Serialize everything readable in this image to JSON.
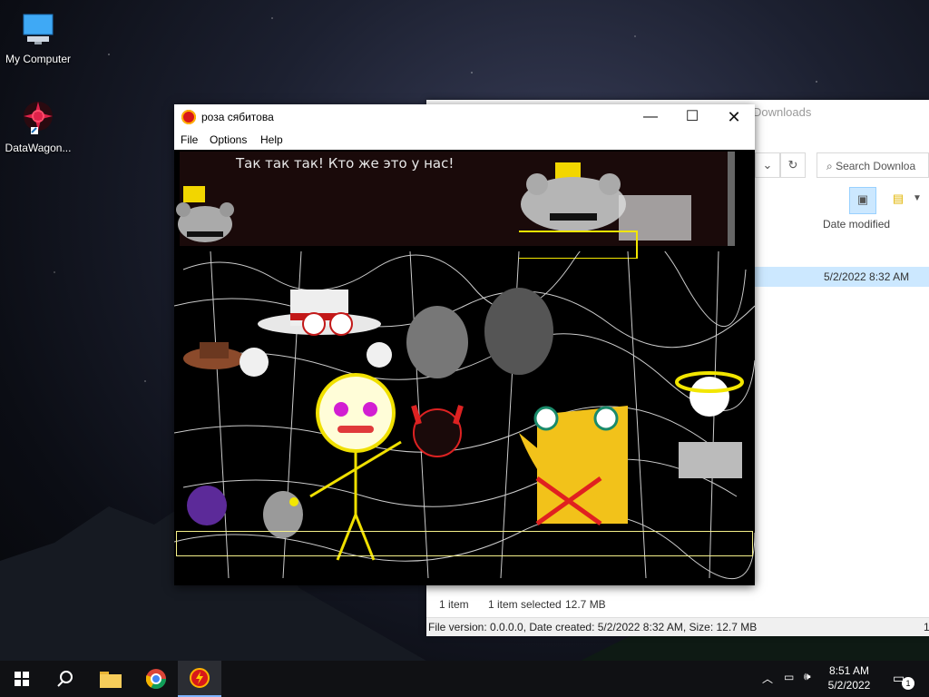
{
  "desktop": {
    "icons": [
      {
        "label": "My Computer",
        "icon": "computer-icon"
      },
      {
        "label": "DataWagon...",
        "icon": "datawagon-shortcut-icon"
      }
    ]
  },
  "explorer": {
    "title": "Downloads",
    "search_placeholder": "Search Downloa",
    "column_header": "Date modified",
    "row_date": "5/2/2022 8:32 AM",
    "status_items": "1 item",
    "status_selected": "1 item selected",
    "status_size": "12.7 MB",
    "info_bar": "File version: 0.0.0.0, Date created: 5/2/2022 8:32 AM, Size: 12.7 MB",
    "info_right": "1"
  },
  "game_window": {
    "title": "роза сябитова",
    "menu": [
      "File",
      "Options",
      "Help"
    ],
    "dialog_text": "Так так так! Кто же это у нас!"
  },
  "taskbar": {
    "time": "8:51 AM",
    "date": "5/2/2022",
    "notification_count": "1"
  },
  "colors": {
    "accent": "#0078d7",
    "selection": "#cce8ff",
    "taskbar": "#101114"
  }
}
